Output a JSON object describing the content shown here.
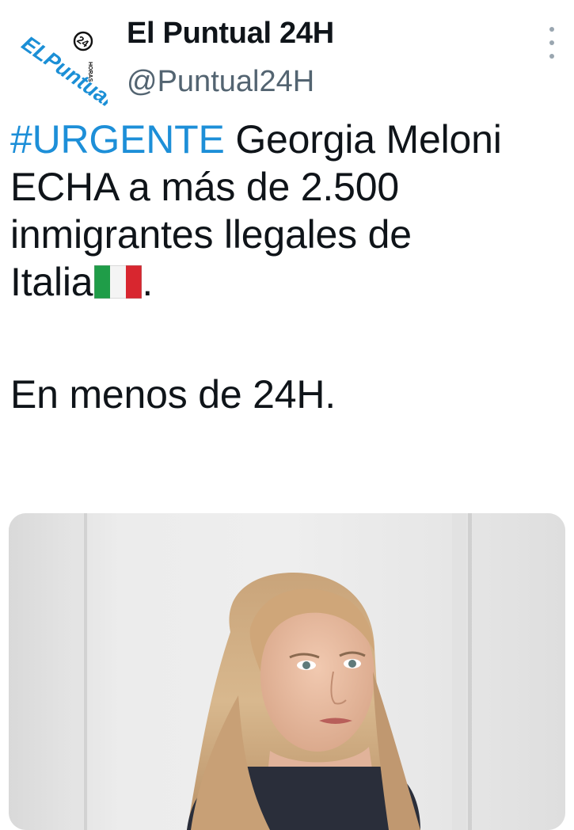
{
  "header": {
    "avatar_logo_text": "ELPuntual",
    "avatar_logo_badge": "24",
    "avatar_logo_sub": "HORAS",
    "display_name": "El Puntual 24H",
    "handle": "@Puntual24H",
    "icon": "more-vertical-icon"
  },
  "tweet": {
    "hashtag": "#URGENTE",
    "line1_rest": " Georgia Meloni",
    "line2": "ECHA a más de 2.500",
    "line3": "inmigrantes llegales de",
    "line4": "Italia",
    "flag": "italy-flag-emoji",
    "line4_end": ".",
    "line5": "En menos de 24H."
  },
  "colors": {
    "hashtag": "#1d8fd8",
    "handle": "#536471",
    "logo": "#1b8fd6",
    "flag_green": "#1f9d48",
    "flag_red": "#d8262f"
  }
}
